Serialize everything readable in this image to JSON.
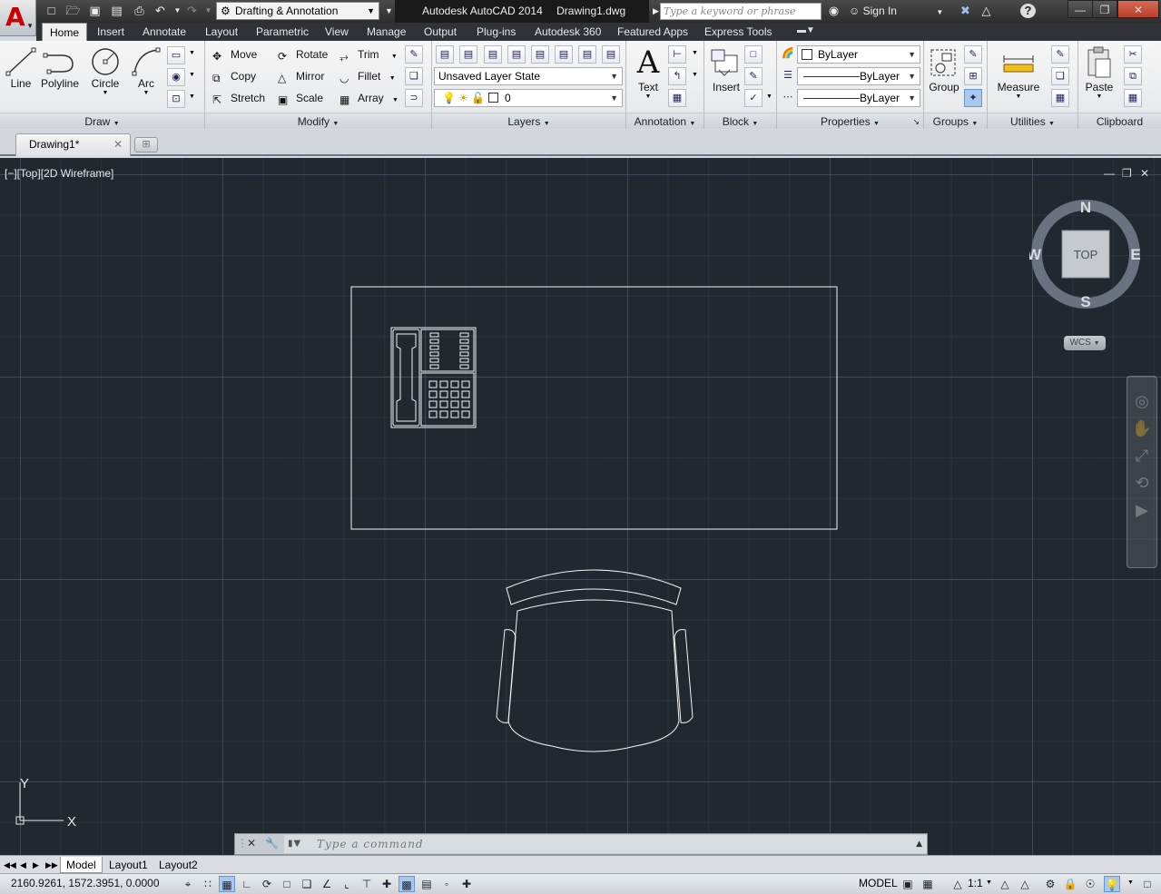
{
  "titlebar": {
    "workspace": "Drafting & Annotation",
    "app_title": "Autodesk AutoCAD 2014",
    "document_title": "Drawing1.dwg",
    "search_placeholder": "Type a keyword or phrase",
    "sign_in": "Sign In"
  },
  "ribbon_tabs": [
    "Home",
    "Insert",
    "Annotate",
    "Layout",
    "Parametric",
    "View",
    "Manage",
    "Output",
    "Plug-ins",
    "Autodesk 360",
    "Featured Apps",
    "Express Tools"
  ],
  "panels": {
    "draw": {
      "title": "Draw",
      "line": "Line",
      "polyline": "Polyline",
      "circle": "Circle",
      "arc": "Arc"
    },
    "modify": {
      "title": "Modify",
      "move": "Move",
      "rotate": "Rotate",
      "trim": "Trim",
      "copy": "Copy",
      "mirror": "Mirror",
      "fillet": "Fillet",
      "stretch": "Stretch",
      "scale": "Scale",
      "array": "Array"
    },
    "layers": {
      "title": "Layers",
      "layer_state": "Unsaved Layer State",
      "current_layer": "0"
    },
    "annotation": {
      "title": "Annotation",
      "text": "Text"
    },
    "block": {
      "title": "Block",
      "insert": "Insert"
    },
    "properties": {
      "title": "Properties",
      "color": "ByLayer",
      "lineweight": "ByLayer",
      "linetype": "ByLayer"
    },
    "groups": {
      "title": "Groups",
      "group": "Group"
    },
    "utilities": {
      "title": "Utilities",
      "measure": "Measure"
    },
    "clipboard": {
      "title": "Clipboard",
      "paste": "Paste"
    }
  },
  "document_tab": "Drawing1*",
  "viewport": {
    "label": "[−][Top][2D Wireframe]",
    "viewcube": {
      "face": "TOP",
      "north": "N",
      "south": "S",
      "east": "E",
      "west": "W",
      "wcs": "WCS"
    },
    "ucs": {
      "x": "X",
      "y": "Y"
    }
  },
  "command_line": {
    "placeholder": "Type a command"
  },
  "layout_tabs": [
    "Model",
    "Layout1",
    "Layout2"
  ],
  "status": {
    "coordinates": "2160.9261, 1572.3951, 0.0000",
    "space": "MODEL",
    "scale": "1:1"
  },
  "colors": {
    "viewport_bg": "#212830",
    "title_bar": "#2e2e2e",
    "active_snap": "#a8c8ee"
  }
}
